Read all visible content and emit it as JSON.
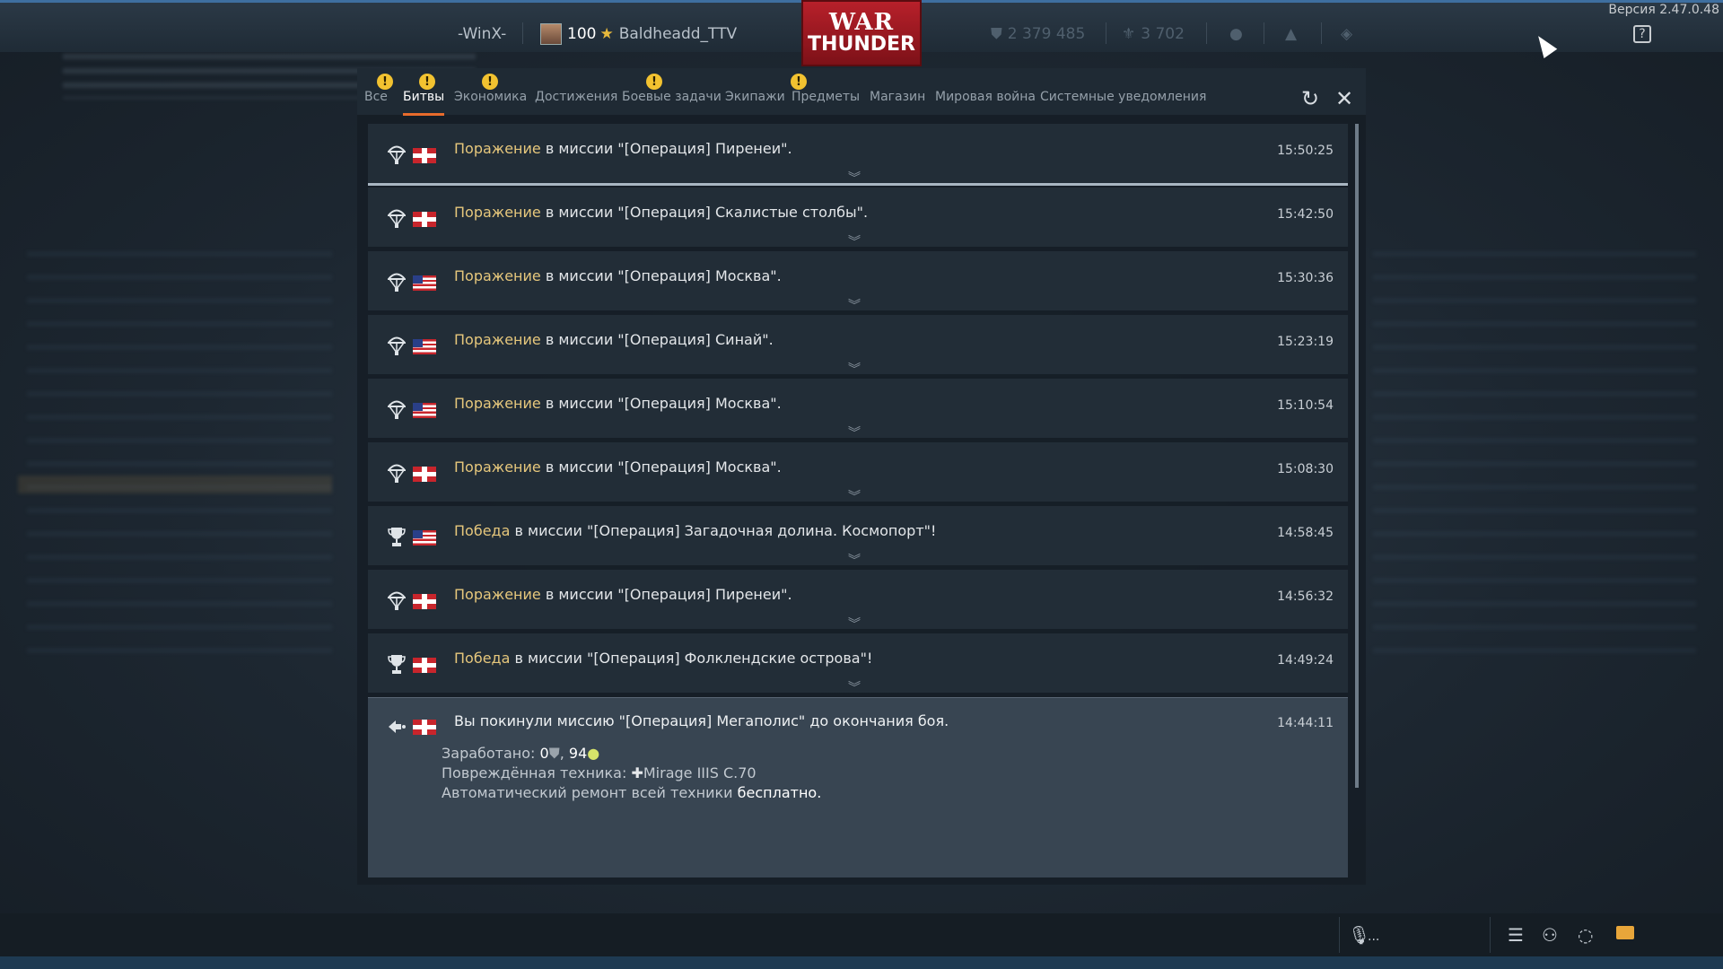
{
  "version": "Версия 2.47.0.48",
  "topbar": {
    "squadron": "-WinX-",
    "rank": "100",
    "username": "Baldheadd_TTV",
    "logo_line1": "WAR",
    "logo_line2": "THUNDER",
    "silver_lions": "2 379 485",
    "golden_eagles": "3 702",
    "help": "?"
  },
  "tabs": [
    {
      "label": "Все",
      "alert": true
    },
    {
      "label": "Битвы",
      "alert": true,
      "active": true
    },
    {
      "label": "Экономика",
      "alert": true
    },
    {
      "label": "Достижения",
      "alert": false
    },
    {
      "label": "Боевые задачи",
      "alert": true
    },
    {
      "label": "Экипажи",
      "alert": false
    },
    {
      "label": "Предметы",
      "alert": true
    },
    {
      "label": "Магазин",
      "alert": false
    },
    {
      "label": "Мировая война",
      "alert": false
    },
    {
      "label": "Системные уведомления",
      "alert": false
    }
  ],
  "alert_glyph": "!",
  "controls": {
    "refresh": "↻",
    "close": "✕"
  },
  "rows": [
    {
      "result": "Поражение",
      "text": " в миссии \"[Операция] Пиренеи\".",
      "time": "15:50:25",
      "flag": "de",
      "icon": "parachute-icon"
    },
    {
      "result": "Поражение",
      "text": " в миссии \"[Операция] Скалистые столбы\".",
      "time": "15:42:50",
      "flag": "de",
      "icon": "parachute-icon"
    },
    {
      "result": "Поражение",
      "text": " в миссии \"[Операция] Москва\".",
      "time": "15:30:36",
      "flag": "us",
      "icon": "parachute-icon"
    },
    {
      "result": "Поражение",
      "text": " в миссии \"[Операция] Синай\".",
      "time": "15:23:19",
      "flag": "us",
      "icon": "parachute-icon"
    },
    {
      "result": "Поражение",
      "text": " в миссии \"[Операция] Москва\".",
      "time": "15:10:54",
      "flag": "us",
      "icon": "parachute-icon"
    },
    {
      "result": "Поражение",
      "text": " в миссии \"[Операция] Москва\".",
      "time": "15:08:30",
      "flag": "de",
      "icon": "parachute-icon"
    },
    {
      "result": "Победа",
      "text": " в миссии \"[Операция] Загадочная долина. Космопорт\"!",
      "time": "14:58:45",
      "flag": "us",
      "icon": "trophy-icon"
    },
    {
      "result": "Поражение",
      "text": " в миссии \"[Операция] Пиренеи\".",
      "time": "14:56:32",
      "flag": "de",
      "icon": "parachute-icon"
    },
    {
      "result": "Победа",
      "text": " в миссии \"[Операция] Фолклендские острова\"!",
      "time": "14:49:24",
      "flag": "de",
      "icon": "trophy-icon"
    }
  ],
  "expanded": {
    "text": "Вы покинули миссию \"[Операция] Мегаполис\" до окончания боя.",
    "time": "14:44:11",
    "flag": "de",
    "earned_label": "Заработано: ",
    "earned_lions": "0",
    "earned_sep": ", ",
    "earned_rp": "94",
    "damaged_label": "Повреждённая техника: ",
    "damaged_vehicle": "Mirage IIIS C.70",
    "repair_label": "Автоматический ремонт всей техники ",
    "repair_value": "бесплатно."
  },
  "bottombar": {
    "voice": "..."
  },
  "colors": {
    "accent": "#e86b2c",
    "result": "#e6c77c",
    "alert": "#f2c230",
    "mail": "#e8a63a"
  }
}
